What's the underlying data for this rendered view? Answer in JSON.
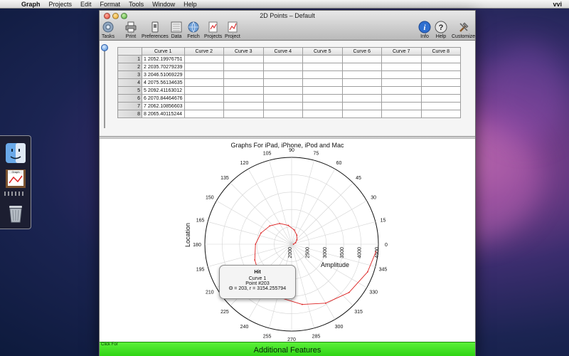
{
  "menubar": {
    "app_name": "Graph",
    "items": [
      "Projects",
      "Edit",
      "Format",
      "Tools",
      "Window",
      "Help"
    ],
    "user": "vvi"
  },
  "window": {
    "title": "2D Points – Default",
    "toolbar": {
      "left": [
        "Tasks",
        "Print",
        "Preferences",
        "Data",
        "Fetch",
        "Projects",
        "Project"
      ],
      "right": [
        "Info",
        "Help",
        "Customize"
      ]
    }
  },
  "table": {
    "columns": [
      "Curve 1",
      "Curve 2",
      "Curve 3",
      "Curve 4",
      "Curve 5",
      "Curve 6",
      "Curve 7",
      "Curve 8"
    ],
    "rows": [
      {
        "num": "1",
        "value": "1 2052.19976751"
      },
      {
        "num": "2",
        "value": "2 2035.70279239"
      },
      {
        "num": "3",
        "value": "3 2046.51069229"
      },
      {
        "num": "4",
        "value": "4 2075.56134635"
      },
      {
        "num": "5",
        "value": "5 2092.41163012"
      },
      {
        "num": "6",
        "value": "6 2070.84464676"
      },
      {
        "num": "7",
        "value": "7 2062.10856603"
      },
      {
        "num": "8",
        "value": "8 2065.40115244"
      }
    ],
    "input_a": "1",
    "input_b": "1"
  },
  "chart_data": {
    "type": "line",
    "subtype": "polar",
    "title": "Graphs For iPad, iPhone, iPod and Mac",
    "xlabel": "Amplitude",
    "ylabel": "Location",
    "angle_ticks": [
      "0",
      "15",
      "30",
      "45",
      "60",
      "75",
      "90",
      "105",
      "120",
      "135",
      "150",
      "165",
      "180",
      "195",
      "210",
      "225",
      "240",
      "255",
      "270",
      "285",
      "300",
      "315",
      "330",
      "345"
    ],
    "radial_ticks": [
      "2000",
      "2500",
      "3000",
      "3500",
      "4000",
      "4500"
    ],
    "radial_range": [
      2000,
      4500
    ],
    "grid": true,
    "series": [
      {
        "name": "Curve 1",
        "color": "#dd2222",
        "points": [
          {
            "theta": 0,
            "r": 2052
          },
          {
            "theta": 20,
            "r": 2120
          },
          {
            "theta": 40,
            "r": 2200
          },
          {
            "theta": 60,
            "r": 2300
          },
          {
            "theta": 80,
            "r": 2420
          },
          {
            "theta": 100,
            "r": 2550
          },
          {
            "theta": 120,
            "r": 2690
          },
          {
            "theta": 140,
            "r": 2820
          },
          {
            "theta": 160,
            "r": 2940
          },
          {
            "theta": 180,
            "r": 3040
          },
          {
            "theta": 203,
            "r": 3154
          },
          {
            "theta": 220,
            "r": 3250
          },
          {
            "theta": 240,
            "r": 3400
          },
          {
            "theta": 260,
            "r": 3580
          },
          {
            "theta": 280,
            "r": 3760
          },
          {
            "theta": 300,
            "r": 3960
          },
          {
            "theta": 320,
            "r": 4160
          },
          {
            "theta": 340,
            "r": 4330
          },
          {
            "theta": 355,
            "r": 4440
          }
        ]
      }
    ]
  },
  "tooltip": {
    "title": "Hit",
    "curve": "Curve 1",
    "point": "Point #203",
    "coords": "Θ = 203, r = 3154.255794"
  },
  "banner": {
    "small": "Click For",
    "big": "Additional Features",
    "color": "#3ee01f"
  }
}
